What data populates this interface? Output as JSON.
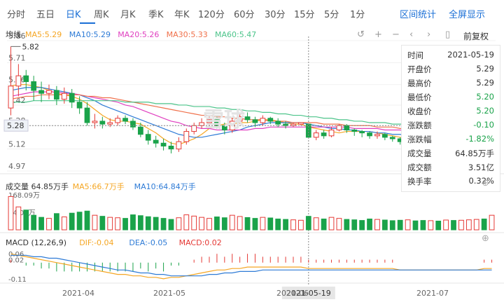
{
  "tabs": [
    "分时",
    "五日",
    "日K",
    "周K",
    "月K",
    "季K",
    "年K",
    "120分",
    "60分",
    "30分",
    "15分",
    "5分",
    "1分"
  ],
  "active_tab": "日K",
  "right_links": [
    "区间统计",
    "全屏显示"
  ],
  "toolbar": {
    "fuquan": "前复权"
  },
  "watermark": "雪球",
  "price_panel": {
    "label": "均线",
    "ma": [
      {
        "name": "MA5:5.29",
        "color": "#f5a623"
      },
      {
        "name": "MA10:5.29",
        "color": "#2e7bd6"
      },
      {
        "name": "MA20:5.26",
        "color": "#e040c0"
      },
      {
        "name": "MA30:5.33",
        "color": "#f0704a"
      },
      {
        "name": "MA60:5.47",
        "color": "#4cc48a"
      }
    ],
    "y_ticks": [
      "5.86",
      "5.71",
      "5.56",
      "5.42",
      "5.28",
      "5.12",
      "4.97"
    ],
    "max_label": "5.82",
    "crosshair_price": "5.28"
  },
  "volume_panel": {
    "labels": [
      {
        "text": "成交量 64.85万手",
        "color": "#333"
      },
      {
        "text": "MA5:66.7万手",
        "color": "#f5a623"
      },
      {
        "text": "MA10:64.84万手",
        "color": "#2e7bd6"
      }
    ],
    "y_ticks": [
      "168.09万",
      "84.05万",
      "0"
    ]
  },
  "macd_panel": {
    "labels": [
      {
        "text": "MACD (12,26,9)",
        "color": "#333"
      },
      {
        "text": "DIF:-0.04",
        "color": "#f5a623"
      },
      {
        "text": "DEA:-0.05",
        "color": "#2e7bd6"
      },
      {
        "text": "MACD:0.02",
        "color": "#e53935"
      }
    ],
    "y_ticks": [
      "0.06",
      "0.02",
      "-0.11"
    ]
  },
  "x_axis": {
    "ticks": [
      "2021-04",
      "2021-05",
      "2021-05-19",
      "2021-06",
      "2021-07"
    ],
    "highlight": "2021-05-19"
  },
  "info_box": {
    "rows": [
      {
        "k": "时间",
        "v": "2021-05-19",
        "c": "#333"
      },
      {
        "k": "开盘价",
        "v": "5.29",
        "c": "#333"
      },
      {
        "k": "最高价",
        "v": "5.29",
        "c": "#333"
      },
      {
        "k": "最低价",
        "v": "5.20",
        "c": "#1aa34a"
      },
      {
        "k": "收盘价",
        "v": "5.20",
        "c": "#1aa34a"
      },
      {
        "k": "涨跌额",
        "v": "-0.10",
        "c": "#1aa34a"
      },
      {
        "k": "涨跌幅",
        "v": "-1.82%",
        "c": "#1aa34a"
      },
      {
        "k": "成交量",
        "v": "64.85万手",
        "c": "#333"
      },
      {
        "k": "成交额",
        "v": "3.51亿",
        "c": "#333"
      },
      {
        "k": "换手率",
        "v": "0.32%",
        "c": "#333"
      }
    ]
  },
  "chart_data": {
    "type": "candlestick",
    "y_range": [
      4.97,
      5.86
    ],
    "highlight_index": 39,
    "colors": {
      "up": "#e53935",
      "down": "#1aa34a"
    },
    "candles": [
      [
        5.4,
        5.55,
        5.82,
        5.35
      ],
      [
        5.55,
        5.62,
        5.7,
        5.48
      ],
      [
        5.62,
        5.58,
        5.66,
        5.52
      ],
      [
        5.58,
        5.52,
        5.62,
        5.45
      ],
      [
        5.52,
        5.5,
        5.58,
        5.44
      ],
      [
        5.5,
        5.52,
        5.56,
        5.46
      ],
      [
        5.52,
        5.46,
        5.55,
        5.42
      ],
      [
        5.46,
        5.5,
        5.54,
        5.43
      ],
      [
        5.5,
        5.44,
        5.53,
        5.4
      ],
      [
        5.44,
        5.4,
        5.48,
        5.36
      ],
      [
        5.4,
        5.3,
        5.44,
        5.28
      ],
      [
        5.3,
        5.31,
        5.36,
        5.26
      ],
      [
        5.31,
        5.29,
        5.34,
        5.26
      ],
      [
        5.29,
        5.3,
        5.33,
        5.27
      ],
      [
        5.3,
        5.33,
        5.35,
        5.28
      ],
      [
        5.33,
        5.31,
        5.35,
        5.29
      ],
      [
        5.31,
        5.27,
        5.33,
        5.25
      ],
      [
        5.27,
        5.22,
        5.3,
        5.2
      ],
      [
        5.22,
        5.18,
        5.25,
        5.15
      ],
      [
        5.18,
        5.16,
        5.21,
        5.13
      ],
      [
        5.16,
        5.14,
        5.19,
        5.11
      ],
      [
        5.14,
        5.12,
        5.17,
        5.09
      ],
      [
        5.12,
        5.17,
        5.2,
        5.1
      ],
      [
        5.17,
        5.24,
        5.26,
        5.15
      ],
      [
        5.24,
        5.28,
        5.3,
        5.22
      ],
      [
        5.28,
        5.3,
        5.33,
        5.26
      ],
      [
        5.3,
        5.32,
        5.35,
        5.28
      ],
      [
        5.32,
        5.28,
        5.34,
        5.26
      ],
      [
        5.28,
        5.25,
        5.3,
        5.22
      ],
      [
        5.25,
        5.31,
        5.33,
        5.23
      ],
      [
        5.31,
        5.34,
        5.36,
        5.29
      ],
      [
        5.34,
        5.32,
        5.37,
        5.3
      ],
      [
        5.32,
        5.3,
        5.34,
        5.27
      ],
      [
        5.3,
        5.33,
        5.35,
        5.28
      ],
      [
        5.33,
        5.31,
        5.34,
        5.29
      ],
      [
        5.31,
        5.29,
        5.33,
        5.27
      ],
      [
        5.29,
        5.28,
        5.31,
        5.26
      ],
      [
        5.28,
        5.29,
        5.3,
        5.27
      ],
      [
        5.29,
        5.3,
        5.3,
        5.28
      ],
      [
        5.29,
        5.2,
        5.29,
        5.2
      ],
      [
        5.2,
        5.23,
        5.25,
        5.18
      ],
      [
        5.23,
        5.21,
        5.25,
        5.19
      ],
      [
        5.21,
        5.25,
        5.27,
        5.2
      ],
      [
        5.25,
        5.28,
        5.29,
        5.24
      ],
      [
        5.28,
        5.25,
        5.29,
        5.23
      ],
      [
        5.25,
        5.24,
        5.26,
        5.21
      ],
      [
        5.24,
        5.23,
        5.25,
        5.2
      ],
      [
        5.23,
        5.21,
        5.24,
        5.19
      ],
      [
        5.21,
        5.22,
        5.24,
        5.19
      ],
      [
        5.22,
        5.2,
        5.23,
        5.18
      ],
      [
        5.2,
        5.19,
        5.21,
        5.17
      ],
      [
        5.19,
        5.17,
        5.2,
        5.15
      ],
      [
        5.17,
        5.18,
        5.2,
        5.15
      ],
      [
        5.18,
        5.15,
        5.19,
        5.13
      ],
      [
        5.15,
        5.12,
        5.17,
        5.1
      ],
      [
        5.12,
        5.14,
        5.16,
        5.1
      ],
      [
        5.14,
        5.1,
        5.16,
        5.08
      ],
      [
        5.1,
        5.13,
        5.17,
        5.09
      ],
      [
        5.13,
        5.08,
        5.14,
        5.07
      ],
      [
        5.08,
        5.09,
        5.11,
        5.06
      ],
      [
        5.09,
        5.1,
        5.12,
        5.07
      ],
      [
        5.1,
        5.12,
        5.14,
        5.08
      ],
      [
        5.12,
        5.09,
        5.13,
        5.07
      ],
      [
        5.09,
        5.11,
        5.13,
        5.08
      ]
    ],
    "volumes": [
      160,
      110,
      95,
      70,
      60,
      55,
      78,
      62,
      80,
      85,
      90,
      70,
      65,
      60,
      58,
      55,
      72,
      68,
      63,
      60,
      55,
      50,
      58,
      72,
      66,
      60,
      55,
      62,
      58,
      70,
      64,
      59,
      55,
      60,
      57,
      52,
      50,
      48,
      46,
      64.85,
      58,
      52,
      60,
      55,
      50,
      48,
      45,
      52,
      50,
      47,
      44,
      46,
      48,
      43,
      45,
      44,
      42,
      47,
      45,
      46,
      48,
      50,
      52,
      70
    ],
    "ma_lines": {
      "MA5": [
        5.55,
        5.56,
        5.56,
        5.55,
        5.54,
        5.52,
        5.5,
        5.49,
        5.48,
        5.46,
        5.43,
        5.39,
        5.35,
        5.32,
        5.31,
        5.31,
        5.3,
        5.29,
        5.26,
        5.23,
        5.19,
        5.16,
        5.15,
        5.17,
        5.19,
        5.22,
        5.26,
        5.28,
        5.29,
        5.29,
        5.3,
        5.3,
        5.31,
        5.32,
        5.32,
        5.31,
        5.3,
        5.29,
        5.29,
        5.27,
        5.26,
        5.25,
        5.24,
        5.23,
        5.24,
        5.24,
        5.24,
        5.24,
        5.23,
        5.22,
        5.21,
        5.2,
        5.19,
        5.18,
        5.16,
        5.15,
        5.14,
        5.13,
        5.12,
        5.11,
        5.1,
        5.1,
        5.1,
        5.1
      ],
      "MA10": [
        5.52,
        5.53,
        5.54,
        5.54,
        5.54,
        5.53,
        5.52,
        5.51,
        5.5,
        5.49,
        5.47,
        5.45,
        5.42,
        5.4,
        5.38,
        5.36,
        5.34,
        5.32,
        5.3,
        5.28,
        5.26,
        5.24,
        5.22,
        5.21,
        5.2,
        5.2,
        5.21,
        5.22,
        5.23,
        5.24,
        5.25,
        5.27,
        5.28,
        5.29,
        5.3,
        5.3,
        5.3,
        5.3,
        5.3,
        5.29,
        5.28,
        5.27,
        5.26,
        5.26,
        5.25,
        5.25,
        5.24,
        5.24,
        5.23,
        5.23,
        5.22,
        5.22,
        5.21,
        5.2,
        5.19,
        5.18,
        5.17,
        5.16,
        5.15,
        5.14,
        5.13,
        5.12,
        5.12,
        5.11
      ],
      "MA20": [
        5.48,
        5.49,
        5.5,
        5.51,
        5.51,
        5.51,
        5.51,
        5.5,
        5.5,
        5.49,
        5.48,
        5.47,
        5.46,
        5.45,
        5.44,
        5.42,
        5.41,
        5.39,
        5.37,
        5.35,
        5.33,
        5.31,
        5.3,
        5.28,
        5.27,
        5.26,
        5.26,
        5.25,
        5.25,
        5.25,
        5.25,
        5.25,
        5.26,
        5.26,
        5.27,
        5.27,
        5.27,
        5.27,
        5.27,
        5.27,
        5.27,
        5.27,
        5.27,
        5.27,
        5.27,
        5.26,
        5.26,
        5.26,
        5.26,
        5.25,
        5.25,
        5.25,
        5.24,
        5.24,
        5.23,
        5.22,
        5.21,
        5.2,
        5.2,
        5.19,
        5.18,
        5.17,
        5.16,
        5.16
      ],
      "MA30": [
        5.46,
        5.47,
        5.48,
        5.48,
        5.49,
        5.49,
        5.49,
        5.49,
        5.49,
        5.49,
        5.48,
        5.48,
        5.47,
        5.47,
        5.46,
        5.45,
        5.44,
        5.43,
        5.42,
        5.41,
        5.4,
        5.39,
        5.38,
        5.37,
        5.36,
        5.35,
        5.35,
        5.34,
        5.34,
        5.33,
        5.33,
        5.32,
        5.32,
        5.32,
        5.31,
        5.31,
        5.31,
        5.3,
        5.3,
        5.3,
        5.3,
        5.29,
        5.29,
        5.29,
        5.28,
        5.28,
        5.28,
        5.28,
        5.27,
        5.27,
        5.27,
        5.26,
        5.26,
        5.26,
        5.25,
        5.25,
        5.24,
        5.24,
        5.23,
        5.23,
        5.22,
        5.22,
        5.21,
        5.21
      ],
      "MA60": [
        5.44,
        5.44,
        5.44,
        5.45,
        5.45,
        5.45,
        5.45,
        5.45,
        5.45,
        5.45,
        5.45,
        5.45,
        5.45,
        5.45,
        5.45,
        5.44,
        5.44,
        5.44,
        5.44,
        5.43,
        5.43,
        5.43,
        5.42,
        5.42,
        5.41,
        5.41,
        5.41,
        5.4,
        5.4,
        5.39,
        5.39,
        5.38,
        5.38,
        5.37,
        5.37,
        5.36,
        5.36,
        5.35,
        5.35,
        5.34,
        5.34,
        5.33,
        5.33,
        5.32,
        5.32,
        5.31,
        5.31,
        5.3,
        5.3,
        5.3,
        5.29,
        5.29,
        5.29,
        5.28,
        5.28,
        5.28,
        5.28,
        5.28,
        5.28,
        5.28,
        5.28,
        5.28,
        5.28,
        5.28
      ]
    },
    "macd": {
      "dif": [
        0.06,
        0.05,
        0.04,
        0.03,
        0.02,
        0.01,
        0.0,
        -0.01,
        -0.02,
        -0.03,
        -0.04,
        -0.05,
        -0.06,
        -0.07,
        -0.08,
        -0.08,
        -0.09,
        -0.09,
        -0.1,
        -0.1,
        -0.11,
        -0.1,
        -0.1,
        -0.09,
        -0.08,
        -0.07,
        -0.06,
        -0.05,
        -0.05,
        -0.04,
        -0.04,
        -0.03,
        -0.03,
        -0.03,
        -0.03,
        -0.03,
        -0.03,
        -0.03,
        -0.03,
        -0.04,
        -0.04,
        -0.04,
        -0.04,
        -0.04,
        -0.04,
        -0.04,
        -0.04,
        -0.04,
        -0.04,
        -0.04,
        -0.04,
        -0.05,
        -0.05,
        -0.05,
        -0.05,
        -0.05,
        -0.05,
        -0.05,
        -0.05,
        -0.05,
        -0.05,
        -0.05,
        -0.04,
        -0.04
      ],
      "dea": [
        0.05,
        0.05,
        0.05,
        0.04,
        0.04,
        0.03,
        0.03,
        0.02,
        0.01,
        0.0,
        -0.01,
        -0.02,
        -0.03,
        -0.04,
        -0.05,
        -0.05,
        -0.06,
        -0.07,
        -0.07,
        -0.08,
        -0.08,
        -0.09,
        -0.09,
        -0.09,
        -0.09,
        -0.09,
        -0.08,
        -0.08,
        -0.07,
        -0.07,
        -0.06,
        -0.06,
        -0.06,
        -0.05,
        -0.05,
        -0.05,
        -0.05,
        -0.05,
        -0.05,
        -0.05,
        -0.05,
        -0.05,
        -0.05,
        -0.05,
        -0.05,
        -0.05,
        -0.05,
        -0.05,
        -0.05,
        -0.05,
        -0.05,
        -0.05,
        -0.05,
        -0.05,
        -0.05,
        -0.05,
        -0.05,
        -0.05,
        -0.05,
        -0.05,
        -0.05,
        -0.05,
        -0.05,
        -0.05
      ],
      "hist": [
        0.02,
        0.0,
        -0.02,
        -0.02,
        -0.04,
        -0.04,
        -0.06,
        -0.06,
        -0.06,
        -0.06,
        -0.06,
        -0.06,
        -0.06,
        -0.06,
        -0.06,
        -0.06,
        -0.06,
        -0.04,
        -0.06,
        -0.04,
        -0.06,
        -0.02,
        -0.02,
        0.0,
        0.02,
        0.04,
        0.04,
        0.06,
        0.04,
        0.06,
        0.04,
        0.06,
        0.06,
        0.04,
        0.04,
        0.04,
        0.04,
        0.04,
        0.04,
        0.02,
        0.02,
        0.02,
        0.02,
        0.02,
        0.02,
        0.02,
        0.02,
        0.02,
        0.02,
        0.02,
        0.02,
        0.0,
        0.0,
        0.0,
        0.0,
        0.0,
        0.0,
        0.0,
        0.0,
        0.0,
        0.0,
        0.0,
        0.02,
        0.02
      ]
    }
  }
}
